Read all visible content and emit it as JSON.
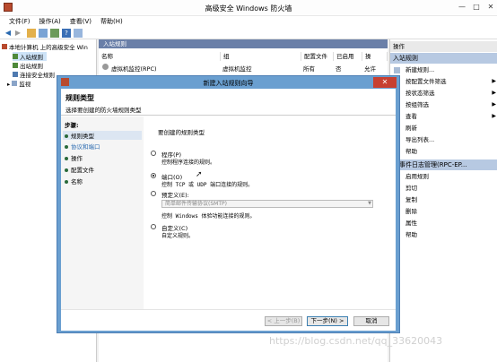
{
  "window": {
    "title": "高级安全 Windows 防火墙",
    "minimize": "—",
    "maximize": "□",
    "close": "✕"
  },
  "menu": [
    "文件(F)",
    "操作(A)",
    "查看(V)",
    "帮助(H)"
  ],
  "tree": {
    "root": "本地计算机 上的高级安全 Win",
    "items": [
      "入站规则",
      "出站规则",
      "连接安全规则",
      "监视"
    ]
  },
  "center": {
    "section": "入站规则",
    "columns": [
      "名称",
      "组",
      "配置文件",
      "已启用",
      "操"
    ],
    "row": {
      "name": "虚拟机监控(RPC)",
      "group": "虚拟机监控",
      "profile": "所有",
      "enabled": "否",
      "action": "允许"
    }
  },
  "actions": {
    "header": "操作",
    "section1": "入站规则",
    "items1": [
      "新建规则...",
      "按配置文件筛选",
      "按状态筛选",
      "按组筛选",
      "查看",
      "刷新",
      "导出列表...",
      "帮助"
    ],
    "section2": "程事件日志管理(RPC-EP...",
    "items2": [
      "启用规则",
      "剪切",
      "复制",
      "删除",
      "属性",
      "帮助"
    ]
  },
  "dialog": {
    "title": "新建入站规则向导",
    "close": "✕",
    "header_title": "规则类型",
    "header_subtitle": "选择要创建的防火墙规则类型",
    "steps_label": "步骤:",
    "steps": [
      "规则类型",
      "协议和端口",
      "操作",
      "配置文件",
      "名称"
    ],
    "question": "要创建的规则类型",
    "options": [
      {
        "label": "程序(P)",
        "desc": "控制程序连接的规则。"
      },
      {
        "label": "端口(O)",
        "desc": "控制 TCP 或 UDP 端口连接的规则。"
      },
      {
        "label": "预定义(E):",
        "desc": "控制 Windows 体验功能连接的规则。"
      },
      {
        "label": "自定义(C)",
        "desc": "自定义规则。"
      }
    ],
    "selected": "端口(O)",
    "predefined_value": "简单邮件传输协议(SMTP)",
    "buttons": {
      "back": "< 上一步(B)",
      "next": "下一步(N) >",
      "cancel": "取消"
    }
  },
  "watermark": "https://blog.csdn.net/qq_33620043"
}
